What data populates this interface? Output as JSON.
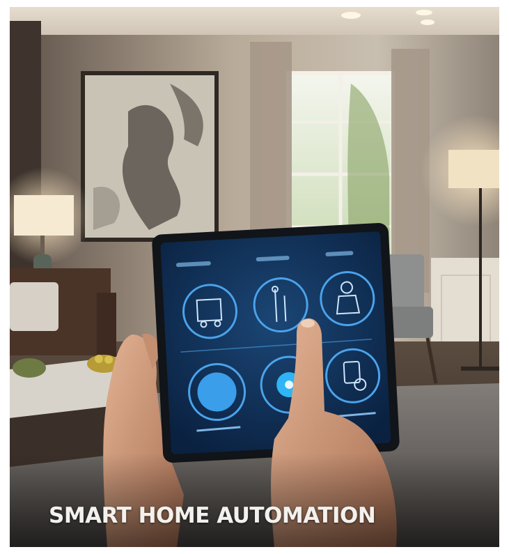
{
  "caption": "SMART HOME AUTOMATION",
  "tablet": {
    "tabs": [
      "",
      "",
      ""
    ]
  },
  "icons": {
    "row1": [
      "appliance-icon",
      "faucet-icon",
      "person-icon"
    ],
    "row2": [
      "thermostat-icon",
      "light-bulb-icon",
      "timer-icon"
    ]
  },
  "colors": {
    "screen_bg": "#0f2c4f",
    "accent": "#3a9eea",
    "caption_text": "#f3f1ee"
  }
}
